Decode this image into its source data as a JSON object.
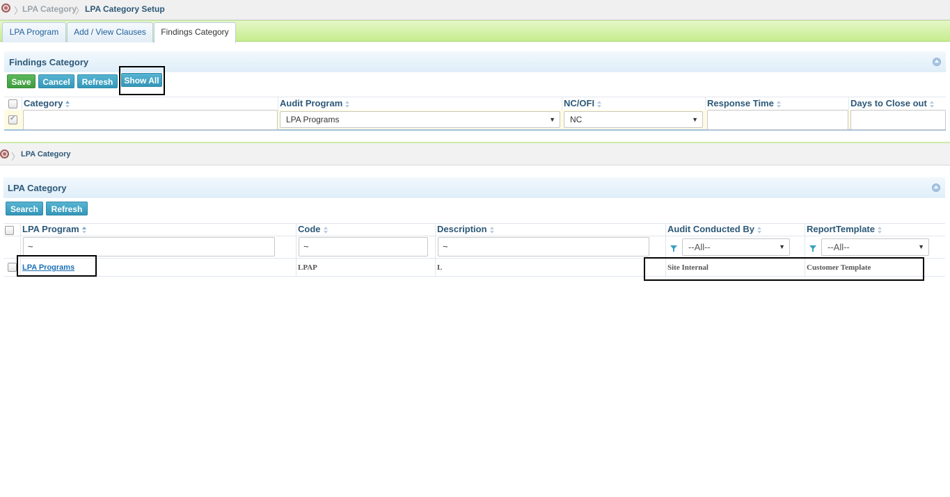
{
  "top_breadcrumb": {
    "items": [
      "LPA Category",
      "LPA Category Setup"
    ]
  },
  "tabs": [
    {
      "label": "LPA Program"
    },
    {
      "label": "Add / View Clauses"
    },
    {
      "label": "Findings Category"
    }
  ],
  "findings_panel": {
    "title": "Findings Category",
    "buttons": {
      "save": "Save",
      "cancel": "Cancel",
      "refresh": "Refresh",
      "show_all": "Show All"
    },
    "columns": [
      "Category",
      "Audit Program",
      "NC/OFI",
      "Response Time",
      "Days to Close out"
    ],
    "row": {
      "category": "",
      "audit_program": "LPA Programs",
      "nc_ofi": "NC",
      "response_time": "",
      "days_to_close": ""
    }
  },
  "lower_breadcrumb": {
    "items": [
      "LPA Category"
    ]
  },
  "category_panel": {
    "title": "LPA Category",
    "buttons": {
      "search": "Search",
      "refresh": "Refresh"
    },
    "columns": [
      "LPA Program",
      "Code",
      "Description",
      "Audit Conducted By",
      "ReportTemplate"
    ],
    "filters": {
      "lpa_program": "~",
      "code": "~",
      "description": "~",
      "audit_conducted_by": "--All--",
      "report_template": "--All--"
    },
    "rows": [
      {
        "lpa_program": "LPA Programs",
        "code": "LPAP",
        "description": "L",
        "audit_conducted_by": "Site Internal",
        "report_template": "Customer Template"
      }
    ]
  },
  "colors": {
    "accent_blue": "#2c5878",
    "save_green": "#4cae4c",
    "button_teal": "#3a9fc0",
    "tab_green": "#c6ec8e"
  },
  "icons": [
    "home-icon",
    "collapse-icon",
    "sort-icon",
    "filter-icon",
    "dropdown-arrow-icon"
  ]
}
